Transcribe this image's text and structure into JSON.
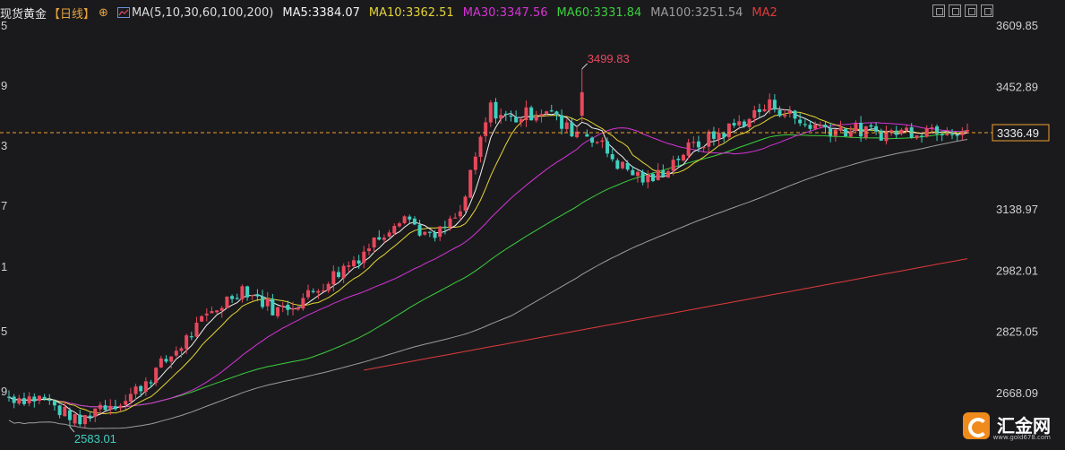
{
  "header": {
    "title": "现货黄金",
    "period": "【日线】",
    "settings_icon": "settings-icon",
    "ma_group": "MA(5,10,30,60,100,200)",
    "ma5": "MA5:3384.07",
    "ma10": "MA10:3362.51",
    "ma30": "MA30:3347.56",
    "ma60": "MA60:3331.84",
    "ma100": "MA100:3251.54",
    "ma200": "MA2"
  },
  "colors": {
    "ma5": "#f2f2f2",
    "ma10": "#e5d434",
    "ma30": "#d633d6",
    "ma60": "#3ccf3c",
    "ma100": "#9c9c9c",
    "ma200": "#e03a3a",
    "up": "#e8485c",
    "down": "#3fd0c0",
    "current": "#f0a030"
  },
  "logo": {
    "name": "汇金网",
    "url": "www.gold678.com"
  },
  "chart_data": {
    "type": "candlestick",
    "y_ticks": [
      "3609.85",
      "3452.89",
      "3138.97",
      "2982.01",
      "2825.05",
      "2668.09"
    ],
    "left_ticks": [
      "5",
      "9",
      "3",
      "7",
      "1",
      "5",
      "9"
    ],
    "ylim": [
      2583,
      3610
    ],
    "current_price": "3336.49",
    "high_label": "3499.83",
    "low_label": "2583.01",
    "legend_placement": "top-left",
    "grid": false
  }
}
